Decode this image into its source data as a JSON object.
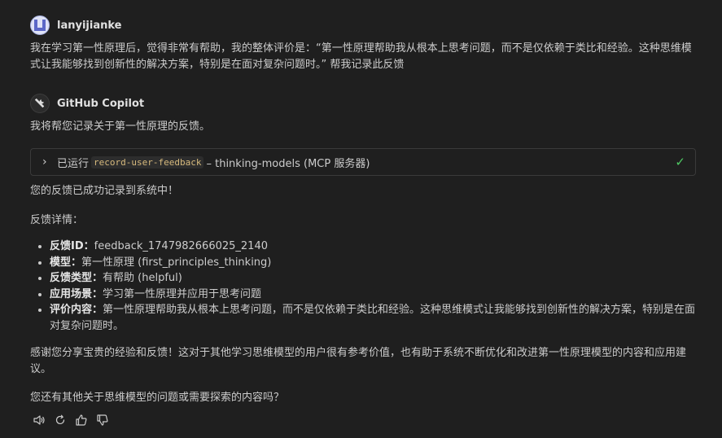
{
  "user": {
    "name": "lanyijianke",
    "message": "我在学习第一性原理后，觉得非常有帮助，我的整体评价是：“第一性原理帮助我从根本上思考问题，而不是仅依赖于类比和经验。这种思维模式让我能够找到创新性的解决方案，特别是在面对复杂问题时。” 帮我记录此反馈"
  },
  "assistant": {
    "name": "GitHub Copilot",
    "intro": "我将帮您记录关于第一性原理的反馈。",
    "tool": {
      "prefix": "已运行",
      "tool_name": "record-user-feedback",
      "suffix": "– thinking-models (MCP 服务器)"
    },
    "success": "您的反馈已成功记录到系统中！",
    "details_heading": "反馈详情：",
    "details": [
      {
        "label": "反馈ID",
        "sep": "：",
        "value": "feedback_1747982666025_2140"
      },
      {
        "label": "模型",
        "sep": "：",
        "value": "第一性原理 (first_principles_thinking)"
      },
      {
        "label": "反馈类型",
        "sep": "：",
        "value": "有帮助 (helpful)"
      },
      {
        "label": "应用场景",
        "sep": "：",
        "value": "学习第一性原理并应用于思考问题"
      },
      {
        "label": "评价内容",
        "sep": "：",
        "value": "第一性原理帮助我从根本上思考问题，而不是仅依赖于类比和经验。这种思维模式让我能够找到创新性的解决方案，特别是在面对复杂问题时。"
      }
    ],
    "thanks": "感谢您分享宝贵的经验和反馈！这对于其他学习思维模型的用户很有参考价值，也有助于系统不断优化和改进第一性原理模型的内容和应用建议。",
    "question": "您还有其他关于思维模型的问题或需要探索的内容吗？"
  },
  "actions": {
    "icons": [
      "speaker-icon",
      "retry-icon",
      "thumbs-up-icon",
      "thumbs-down-icon"
    ]
  },
  "colors": {
    "background": "#1f1f1f",
    "text": "#cccccc",
    "check": "#4ec963",
    "code": "#d7ba7d"
  }
}
